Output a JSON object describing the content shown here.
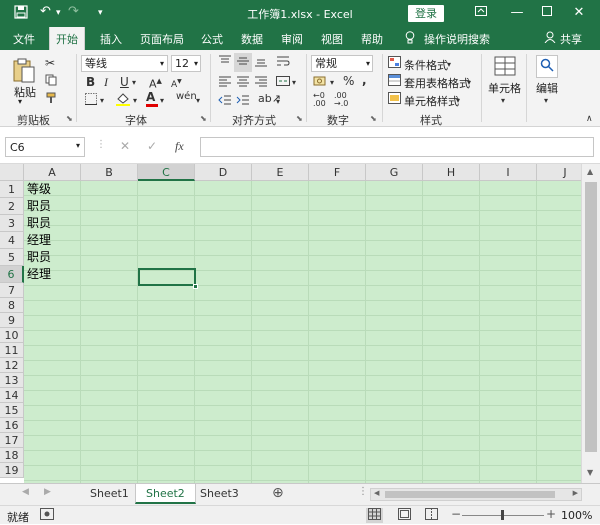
{
  "title": {
    "filename": "工作簿1.xlsx",
    "separator": "-",
    "app": "Excel",
    "login": "登录",
    "qa_undo": "↶",
    "qa_redo": "↷",
    "qa_custom": "▾"
  },
  "tabs": [
    {
      "label": "文件"
    },
    {
      "label": "开始"
    },
    {
      "label": "插入"
    },
    {
      "label": "页面布局"
    },
    {
      "label": "公式"
    },
    {
      "label": "数据"
    },
    {
      "label": "审阅"
    },
    {
      "label": "视图"
    },
    {
      "label": "帮助"
    },
    {
      "label": "操作说明搜索"
    },
    {
      "label": "共享"
    }
  ],
  "ribbon": {
    "clipboard": {
      "paste": "粘贴",
      "label": "剪贴板"
    },
    "font": {
      "name": "等线",
      "size": "12",
      "bold": "B",
      "italic": "I",
      "underline": "U",
      "label": "字体"
    },
    "align": {
      "label": "对齐方式"
    },
    "number": {
      "format": "常规",
      "percent": "%",
      "label": "数字"
    },
    "styles": {
      "cond": "条件格式",
      "table": "套用表格格式",
      "cell": "单元格样式",
      "label": "样式"
    },
    "cells": {
      "label": "单元格"
    },
    "editing": {
      "label": "编辑"
    }
  },
  "formula": {
    "namebox": "C6",
    "fx": "fx",
    "value": ""
  },
  "columns": [
    "A",
    "B",
    "C",
    "D",
    "E",
    "F",
    "G",
    "H",
    "I",
    "J"
  ],
  "rows": [
    "1",
    "2",
    "3",
    "4",
    "5",
    "6",
    "7",
    "8",
    "9",
    "10",
    "11",
    "12",
    "13",
    "14",
    "15",
    "16",
    "17",
    "18",
    "19"
  ],
  "cells": {
    "A1": "等级",
    "A2": "职员",
    "A3": "职员",
    "A4": "经理",
    "A5": "职员",
    "A6": "经理"
  },
  "sheets": [
    "Sheet1",
    "Sheet2",
    "Sheet3"
  ],
  "active_sheet": "Sheet2",
  "status": {
    "ready": "就绪",
    "zoom": "100%"
  },
  "colors": {
    "accent": "#217346",
    "cell_bg": "#cdeccd"
  }
}
